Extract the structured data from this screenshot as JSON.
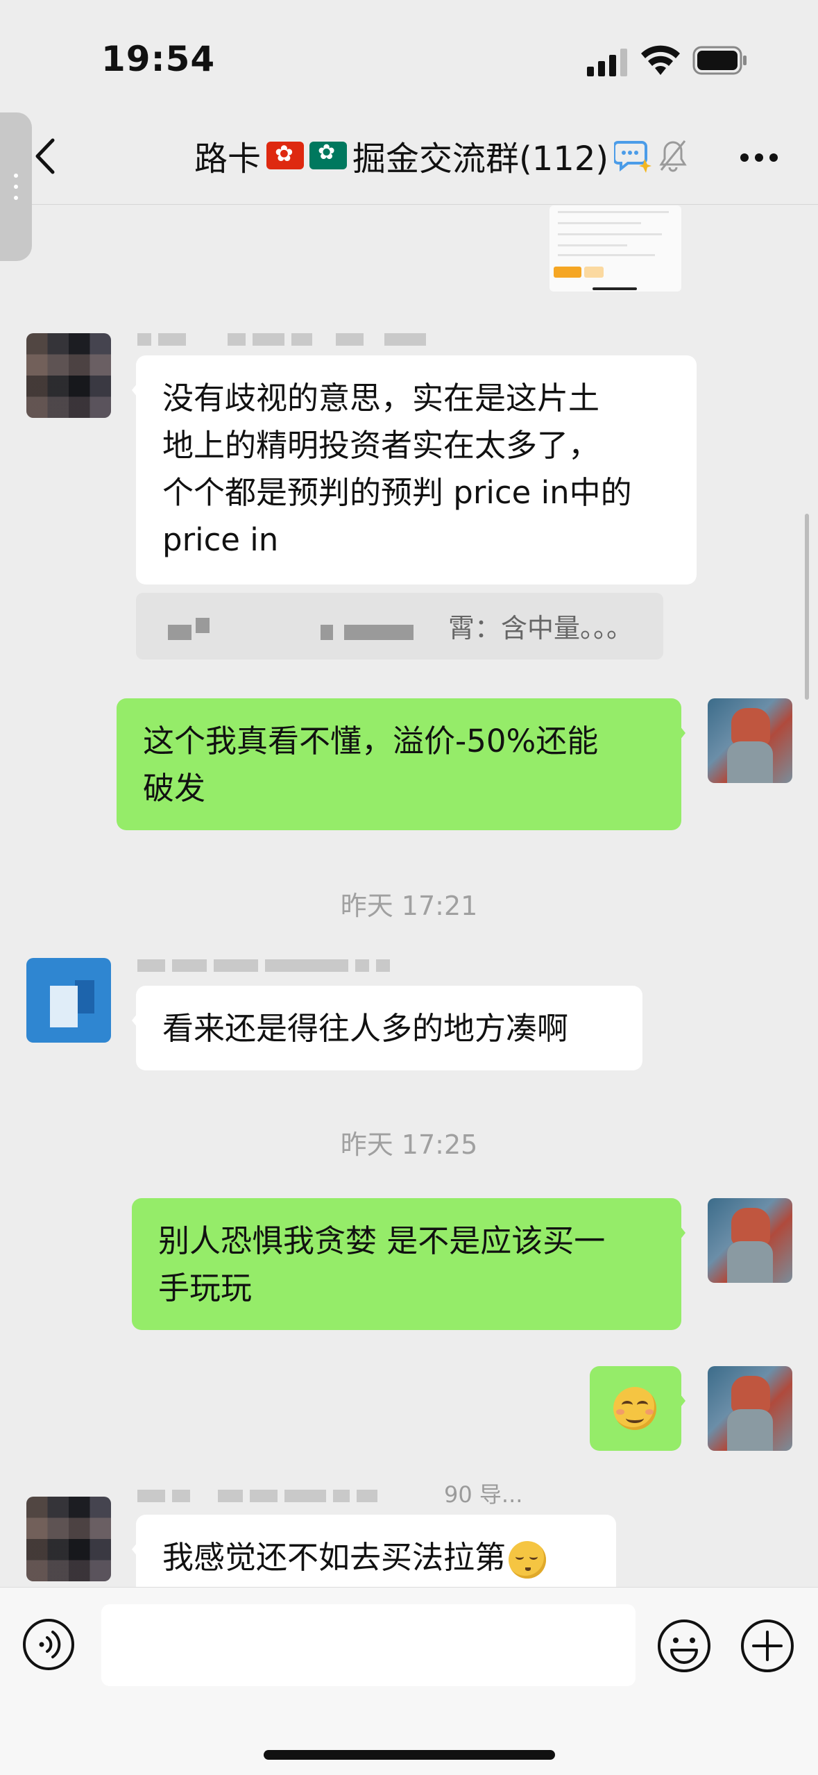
{
  "status_bar": {
    "time": "19:54"
  },
  "nav": {
    "title_prefix": "路卡",
    "title_main": "掘金交流群(112)",
    "back_icon": "chevron-left-icon",
    "more_icon": "more-dots-icon"
  },
  "messages": [
    {
      "side": "left",
      "avatar": "pixelated",
      "text": "没有歧视的意思，实在是这片土\n地上的精明投资者实在太多了，\n个个都是预判的预判 price in中的\nprice in",
      "quote_visible": "霄：含中量。。。"
    },
    {
      "side": "right",
      "text": "这个我真看不懂，溢价-50%还能\n破发"
    },
    {
      "type": "timestamp",
      "text": "昨天 17:21"
    },
    {
      "side": "left",
      "avatar": "blue",
      "text": "看来还是得往人多的地方凑啊"
    },
    {
      "type": "timestamp",
      "text": "昨天 17:25"
    },
    {
      "side": "right",
      "text": "别人恐惧我贪婪 是不是应该买一\n手玩玩"
    },
    {
      "side": "right",
      "type": "emoji",
      "emoji": "smirk-face"
    },
    {
      "side": "left",
      "avatar": "pixelated",
      "nickname_tail": "90 导...",
      "text": "我感觉还不如去买法拉第",
      "emoji_tail": "unamused-face"
    }
  ],
  "input_bar": {
    "voice_icon": "voice-icon",
    "emoji_icon": "emoji-icon",
    "plus_icon": "plus-circle-icon",
    "value": ""
  },
  "colors": {
    "background": "#ededed",
    "bubble_self": "#95ec69",
    "bubble_other": "#ffffff",
    "timestamp": "#a0a0a0"
  }
}
